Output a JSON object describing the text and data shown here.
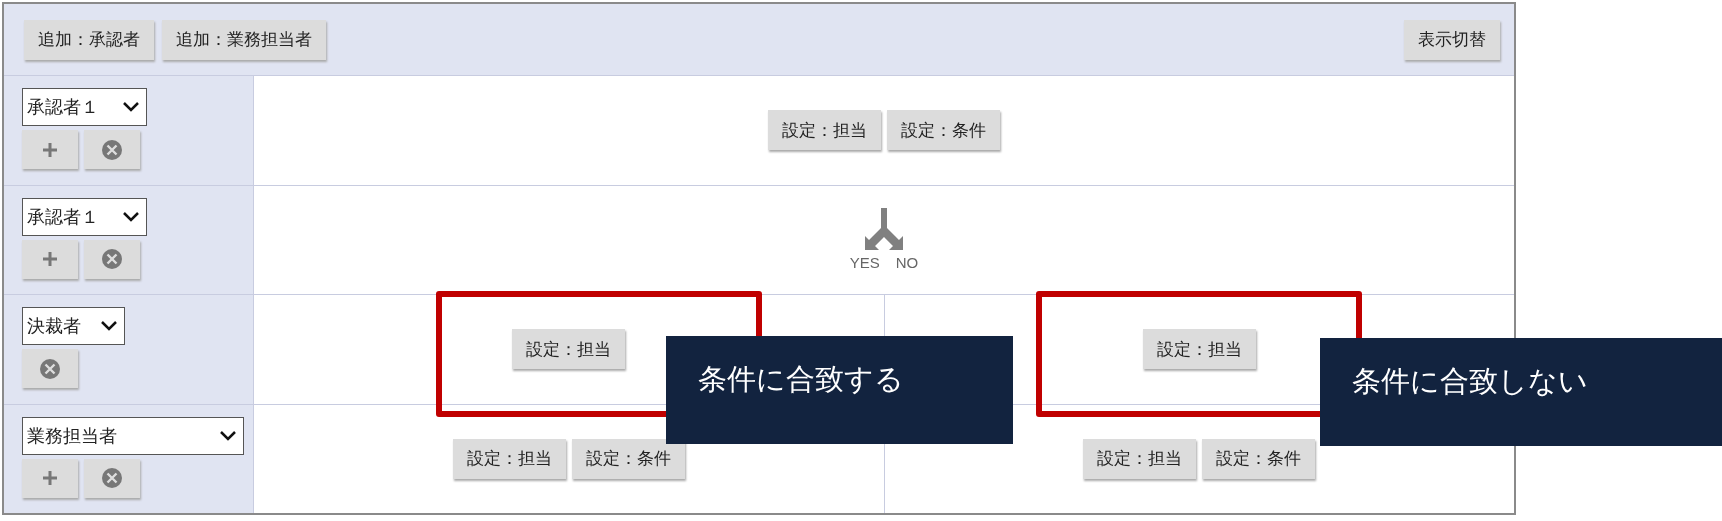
{
  "toolbar": {
    "buttons": [
      "追加：承認者",
      "追加：業務担当者"
    ],
    "right_button": "表示切替"
  },
  "rows": [
    {
      "select": "承認者１",
      "wide": false,
      "add_button": true,
      "cells": [
        {
          "kind": "buttons",
          "buttons": [
            "設定：担当",
            "設定：条件"
          ]
        }
      ]
    },
    {
      "select": "承認者１",
      "wide": false,
      "add_button": true,
      "cells": [
        {
          "kind": "branch",
          "yes": "YES",
          "no": "NO"
        }
      ]
    },
    {
      "select": "決裁者",
      "wide": false,
      "add_button": false,
      "cells": [
        {
          "kind": "buttons",
          "buttons": [
            "設定：担当"
          ]
        },
        {
          "kind": "buttons",
          "buttons": [
            "設定：担当"
          ]
        }
      ]
    },
    {
      "select": "業務担当者",
      "wide": true,
      "add_button": true,
      "cells": [
        {
          "kind": "buttons",
          "buttons": [
            "設定：担当",
            "設定：条件"
          ]
        },
        {
          "kind": "buttons",
          "buttons": [
            "設定：担当",
            "設定：条件"
          ]
        }
      ]
    }
  ],
  "callouts": [
    {
      "label": "条件に合致する"
    },
    {
      "label": "条件に合致しない"
    }
  ]
}
